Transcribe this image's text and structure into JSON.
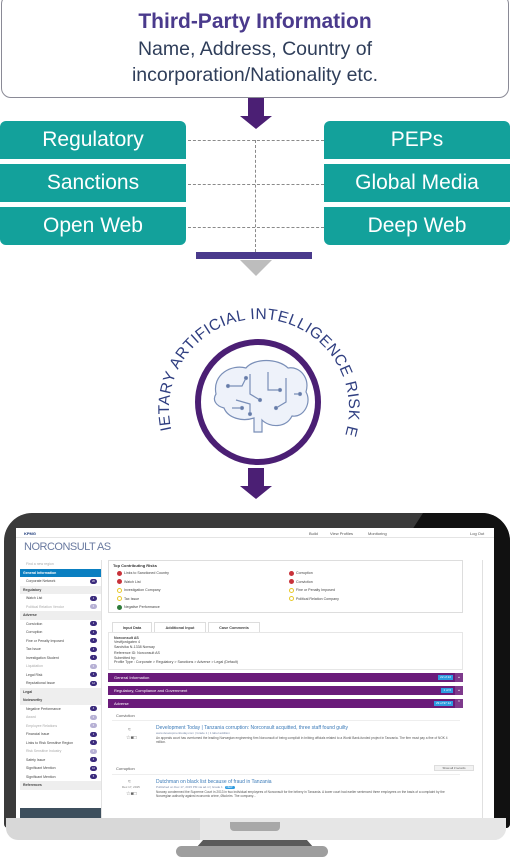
{
  "header_box": {
    "title": "Third-Party Information",
    "subtitle_line1": "Name, Address, Country of",
    "subtitle_line2": "incorporation/Nationality etc."
  },
  "sources": {
    "left": [
      "Regulatory",
      "Sanctions",
      "Open Web"
    ],
    "right": [
      "PEPs",
      "Global Media",
      "Deep Web"
    ]
  },
  "engine": {
    "label": "PROPRIETARY ARTIFICIAL INTELLIGENCE RISK ENGINE",
    "icon": "brain-circuit-icon"
  },
  "colors": {
    "purple": "#4b1f74",
    "teal": "#13a19b",
    "collector": "#4a3a8c",
    "bar_purple": "#6a1b7a"
  },
  "app": {
    "logo": "KPMG",
    "nav": [
      "Build",
      "View Profiles",
      "Monitoring"
    ],
    "logout": "Log Out",
    "company_name": "NORCONSULT AS",
    "sidebar": [
      {
        "label": "Find a new region",
        "type": "link"
      },
      {
        "label": "General Information",
        "type": "active"
      },
      {
        "label": "Corporate Network",
        "badge": "20"
      },
      {
        "label": "Regulatory",
        "type": "section"
      },
      {
        "label": "Watch List",
        "badge": "1"
      },
      {
        "label": "Political Relation Vendor",
        "badge": "0",
        "dim": true
      },
      {
        "label": "Adverse",
        "type": "section"
      },
      {
        "label": "Conviction",
        "badge": "1"
      },
      {
        "label": "Corruption",
        "badge": "1"
      },
      {
        "label": "Fine or Penalty Imposed",
        "badge": "1"
      },
      {
        "label": "Tax Issue",
        "badge": "1"
      },
      {
        "label": "Investigation Student",
        "badge": "1"
      },
      {
        "label": "Liquidation",
        "badge": "0",
        "dim": true
      },
      {
        "label": "Legal Risk",
        "badge": "1"
      },
      {
        "label": "Reputational Issue",
        "badge": "12"
      },
      {
        "label": "Legal",
        "type": "section"
      },
      {
        "label": "Noteworthy",
        "type": "section"
      },
      {
        "label": "Negative Performance",
        "badge": "4"
      },
      {
        "label": "Award",
        "badge": "0",
        "dim": true
      },
      {
        "label": "Employee Relations",
        "badge": "0",
        "dim": true
      },
      {
        "label": "Financial Issue",
        "badge": "1"
      },
      {
        "label": "Links to Risk Sensitive Region",
        "badge": "2"
      },
      {
        "label": "Risk Sensitive Industry",
        "badge": "0",
        "dim": true
      },
      {
        "label": "Safety Issue",
        "badge": "2"
      },
      {
        "label": "Significant Mention",
        "badge": "16"
      },
      {
        "label": "Significant Mention",
        "badge": "5"
      },
      {
        "label": "References",
        "type": "section"
      }
    ],
    "risks": {
      "title": "Top Contributing Risks",
      "left": [
        {
          "label": "Links to Sanctioned Country",
          "level": "red"
        },
        {
          "label": "Watch List",
          "level": "red"
        },
        {
          "label": "Investigation Company",
          "level": "yellow"
        },
        {
          "label": "Tax Issue",
          "level": "yellow"
        },
        {
          "label": "Negative Performance",
          "level": "green"
        }
      ],
      "right": [
        {
          "label": "Corruption",
          "level": "red"
        },
        {
          "label": "Conviction",
          "level": "red"
        },
        {
          "label": "Fine or Penalty Imposed",
          "level": "yellow"
        },
        {
          "label": "Political Relation Company",
          "level": "yellow"
        }
      ]
    },
    "tabs": [
      "Input Data",
      "Additional Input",
      "Case Comments"
    ],
    "input_data": [
      "Norconsult AS",
      "Vestfjordgaten 4",
      "Sandvika N-1338 Norway",
      "Reference ID: Norconsult AS",
      "Submitted by:",
      "Profile Type : Corporate > Regulatory > Sanctions > Adverse > Legal (Default)"
    ],
    "bars": [
      {
        "label": "General Information",
        "count": "22 of 22",
        "chevron": "v"
      },
      {
        "label": "Regulatory, Compliance and Government",
        "count": "1 of 6",
        "chevron": "v"
      },
      {
        "label": "Adverse",
        "count": "29 of 97 12",
        "chevron": "^"
      }
    ],
    "adverse": {
      "sections": [
        {
          "label": "Conviction",
          "title": "Development Today | Tanzania corruption: Norconsult acquitted, three staff found guilty",
          "meta": "www.developmenttoday.com | Grade 1 | 1 label addition",
          "body": "An appeals court has overturned the leading Norwegian engineering firm Norconsult of being complicit in bribing officials related to a World Bank-funded project in Tanzania. The firm must pay a fine of NOK 4 million."
        },
        {
          "label": "Corruption",
          "show_all": "Show all 3 records",
          "date": "Dec 17, 2015",
          "title": "Dutchman on black list because of fraud in Tanzania",
          "meta": "Published on Dec 17, 2015 PM via ad.nl | Grade 1",
          "badge": "NEW",
          "body": "Norway condemned the Supreme Court in 2013 in two individual employees of Norconsult for the bribery in Tanzania. A lower court had earlier sentenced three employees on the basis of a complaint by the Norwegian authority against economic crime, Økokrim. The company..."
        }
      ]
    }
  }
}
